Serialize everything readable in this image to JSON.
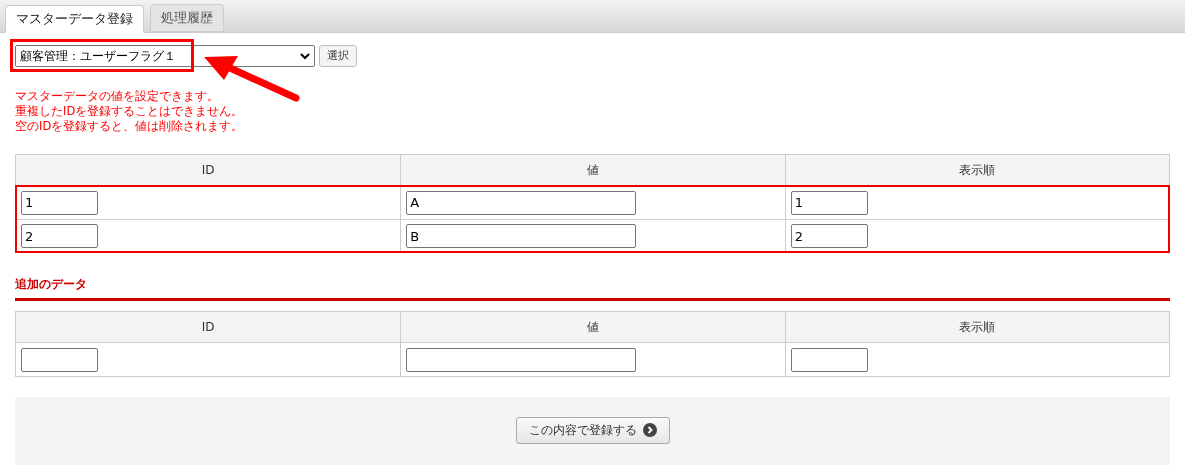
{
  "tabs": [
    {
      "label": "マスターデータ登録",
      "selected": true
    },
    {
      "label": "処理履歴",
      "selected": false
    }
  ],
  "master_select": {
    "value": "顧客管理：ユーザーフラグ１",
    "button": "選択"
  },
  "notes": [
    "マスターデータの値を設定できます。",
    "重複したIDを登録することはできません。",
    "空のIDを登録すると、値は削除されます。"
  ],
  "table": {
    "columns": [
      "ID",
      "値",
      "表示順"
    ],
    "rows": [
      {
        "id": "1",
        "value": "A",
        "order": "1"
      },
      {
        "id": "2",
        "value": "B",
        "order": "2"
      }
    ]
  },
  "additional": {
    "title": "追加のデータ",
    "columns": [
      "ID",
      "値",
      "表示順"
    ]
  },
  "submit_button": "この内容で登録する"
}
